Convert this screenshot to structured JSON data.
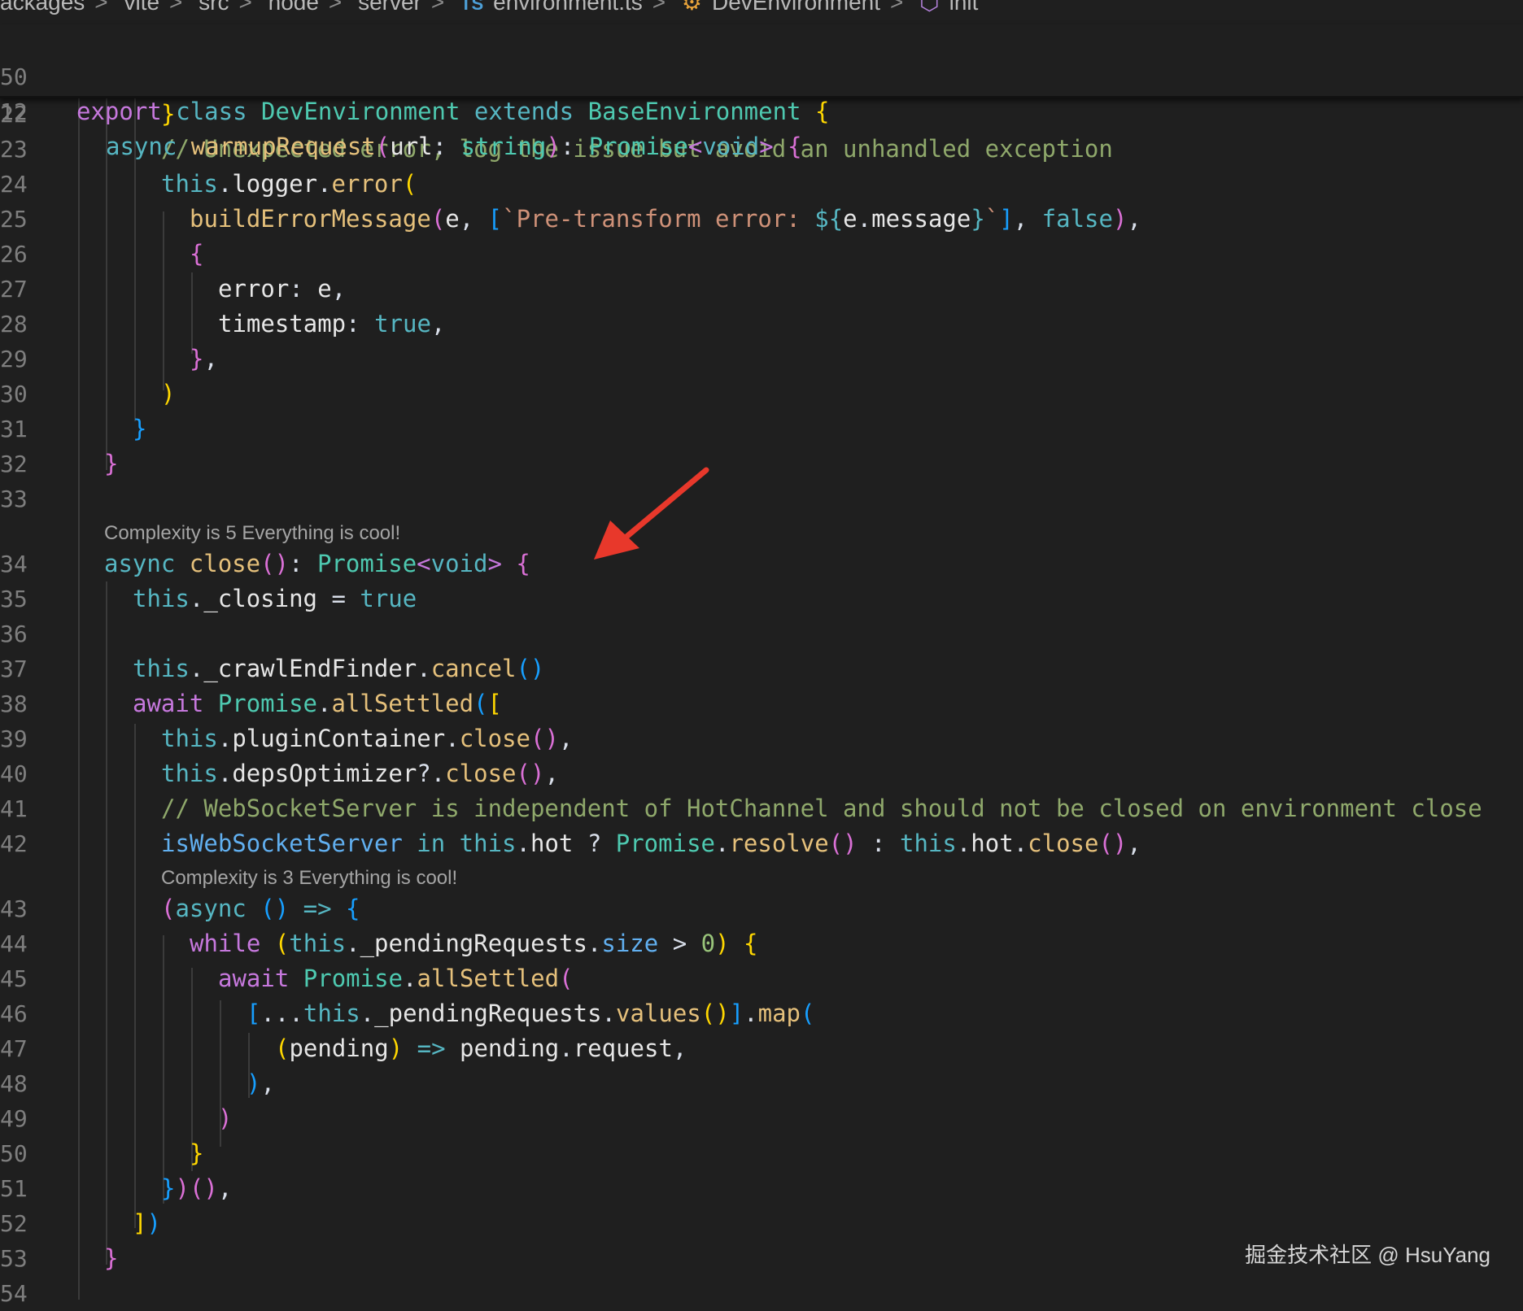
{
  "breadcrumb": {
    "items": [
      "ackages",
      "vite",
      "src",
      "node",
      "server"
    ],
    "file_badge": "TS",
    "file": "environment.ts",
    "class_name": "DevEnvironment",
    "method_name": "init",
    "separator": ">"
  },
  "sticky": {
    "line1_no": "50",
    "line2_no": "12"
  },
  "lens": {
    "close_complexity": "Complexity is 5 Everything is cool!",
    "async_complexity": "Complexity is 3 Everything is cool!"
  },
  "line_numbers": [
    "22",
    "23",
    "24",
    "25",
    "26",
    "27",
    "28",
    "29",
    "30",
    "31",
    "32",
    "33",
    "34",
    "35",
    "36",
    "37",
    "38",
    "39",
    "40",
    "41",
    "42",
    "43",
    "44",
    "45",
    "46",
    "47",
    "48",
    "49",
    "50",
    "51",
    "52",
    "53",
    "54"
  ],
  "watermark": "掘金技术社区 @ HsuYang"
}
